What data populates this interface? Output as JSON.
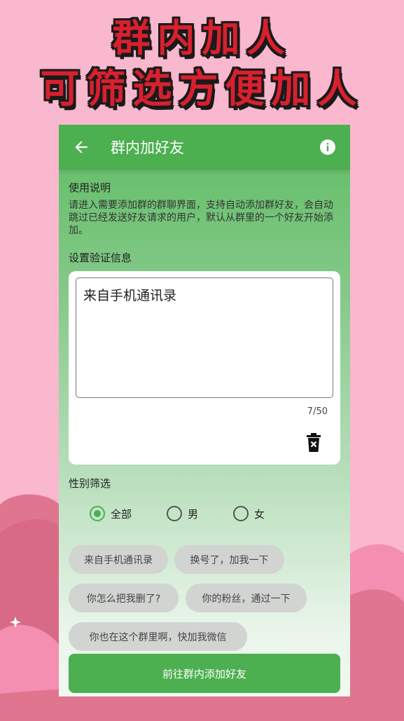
{
  "promo": {
    "headline_line1": "群内加人",
    "headline_line2": "可筛选方便加人"
  },
  "appbar": {
    "title": "群内加好友",
    "back_icon": "arrow-left-icon",
    "info_icon": "info-icon"
  },
  "instructions": {
    "heading": "使用说明",
    "body": "请进入需要添加群的群聊界面，支持自动添加群好友，会自动跳过已经发送好友请求的用户，默认从群里的一个好友开始添加。"
  },
  "verify": {
    "heading": "设置验证信息",
    "value": "来自手机通讯录",
    "counter": "7/50",
    "clear_icon": "trash-icon"
  },
  "gender": {
    "heading": "性别筛选",
    "options": [
      "全部",
      "男",
      "女"
    ],
    "selected": "全部"
  },
  "presets": [
    "来自手机通讯录",
    "换号了，加我一下",
    "你怎么把我删了?",
    "你的粉丝，通过一下",
    "你也在这个群里啊，快加我微信"
  ],
  "submit_label": "前往群内添加好友",
  "colors": {
    "background": "#f9b8cd",
    "accent": "#4caf50",
    "headline": "#d8202e"
  }
}
